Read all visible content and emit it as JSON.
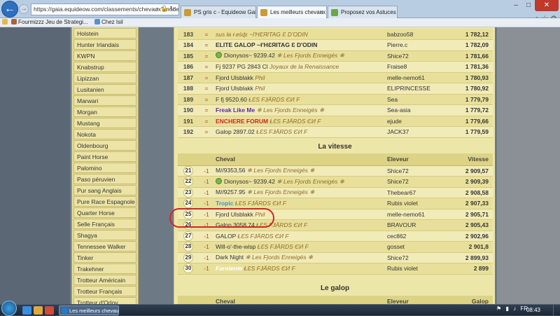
{
  "browser": {
    "address": "https://gaia.equideow.com/classements/chevaux?mode=purs",
    "tabs": [
      {
        "label": "PS gris c - Equideow Gaia"
      },
      {
        "label": "Les meilleurs chevaux - Equ..."
      },
      {
        "label": "Proposez vos Astuces"
      }
    ],
    "favorites": [
      {
        "label": "Fourmizzz  Jeu de Strategi..."
      },
      {
        "label": "Chez Isil"
      }
    ]
  },
  "sidebar": {
    "items": [
      {
        "label": "Holstein"
      },
      {
        "label": "Hunter Irlandais"
      },
      {
        "label": "KWPN"
      },
      {
        "label": "Knabstrup"
      },
      {
        "label": "Lipizzan"
      },
      {
        "label": "Lusitanien"
      },
      {
        "label": "Marwari"
      },
      {
        "label": "Morgan"
      },
      {
        "label": "Mustang"
      },
      {
        "label": "Nokota"
      },
      {
        "label": "Oldenbourg"
      },
      {
        "label": "Paint Horse"
      },
      {
        "label": "Palomino"
      },
      {
        "label": "Paso péruvien"
      },
      {
        "label": "Pur sang Anglais"
      },
      {
        "label": "Pure Race Espagnole"
      },
      {
        "label": "Quarter Horse"
      },
      {
        "label": "Selle Français"
      },
      {
        "label": "Shagya"
      },
      {
        "label": "Tennessee Walker"
      },
      {
        "label": "Tinker"
      },
      {
        "label": "Trakehner"
      },
      {
        "label": "Trotteur Américain"
      },
      {
        "label": "Trotteur Français"
      },
      {
        "label": "Trotteur d'Orlov"
      }
    ]
  },
  "top_table": {
    "rows": [
      {
        "rank": "183",
        "delta": "=",
        "horse": "sus ła ғ๏śɖɛ ~ɫ'HƐЯITAG Ɛ D'ODIN",
        "association": "",
        "owner": "babzoo58",
        "value": "1 782,12"
      },
      {
        "rank": "184",
        "delta": "=",
        "horse": "ELITE GALOP ~ɫ'HƐЯITAG Ɛ D'ODIN",
        "association": "",
        "owner": "Pierre.c",
        "value": "1 782,09"
      },
      {
        "rank": "185",
        "delta": "=",
        "horse": "Dionysos~ 9239.42",
        "association": "❄ Les Fjords Enneigés ❄",
        "owner": "Shice72",
        "value": "1 781,66"
      },
      {
        "rank": "186",
        "delta": "=",
        "horse": "Fj 9237 PG 2843 Cl",
        "association": "Joyaux de la Renaissance",
        "owner": "Fraise8",
        "value": "1 781,36"
      },
      {
        "rank": "187",
        "delta": "=",
        "horse": "Fjord Ulsblakk",
        "association": "Phil",
        "owner": "melle-nemo61",
        "value": "1 780,93"
      },
      {
        "rank": "188",
        "delta": "=",
        "horse": "Fjord Ulsblakk",
        "association": "Phil",
        "owner": "ELIPRINCESSE",
        "value": "1 780,92"
      },
      {
        "rank": "189",
        "delta": "=",
        "horse": "F fj 9520.60",
        "association": "ⱢƐS FɈӒRDS ЄИ F",
        "owner": "Sea",
        "value": "1 779,79"
      },
      {
        "rank": "190",
        "delta": "=",
        "horse": "Freak Like Me",
        "association": "❄ Les Fjords Enneigés ❄",
        "owner": "Sea-asia",
        "value": "1 779,72"
      },
      {
        "rank": "191",
        "delta": "=",
        "horse": "ENCHERE FORUM",
        "association": "ⱢƐS FɈӒRDS ЄИ F",
        "owner": "ejude",
        "value": "1 779,66"
      },
      {
        "rank": "192",
        "delta": "=",
        "horse": "Galop 2897.02",
        "association": "ⱢƐS FɈӒRDS ЄИ F",
        "owner": "JACK37",
        "value": "1 779,59"
      }
    ]
  },
  "vitesse": {
    "title": "La vitesse",
    "headers": {
      "horse": "Cheval",
      "owner": "Eleveur",
      "value": "Vitesse"
    },
    "rows": [
      {
        "rank": "21",
        "delta": "-1",
        "horse": "M//9353,56",
        "association": "❄ Les Fjords Enneigés ❄",
        "owner": "Shice72",
        "value": "2 909,57"
      },
      {
        "rank": "22",
        "delta": "-1",
        "horse": "Dionysos~ 9239.42",
        "association": "❄ Les Fjords Enneigés ❄",
        "owner": "Shice72",
        "value": "2 909,39"
      },
      {
        "rank": "23",
        "delta": "-1",
        "horse": "M//9257.95",
        "association": "❄ Les Fjords Enneigés ❄",
        "owner": "Thebear67",
        "value": "2 908,58"
      },
      {
        "rank": "24",
        "delta": "-1",
        "horse": "Tropic",
        "association": "ⱢƐS FɈӒRDS ЄИ F",
        "owner": "Rubis violet",
        "value": "2 907,33"
      },
      {
        "rank": "25",
        "delta": "-1",
        "horse": "Fjord Ulsblakk",
        "association": "Phil",
        "owner": "melle-nemo61",
        "value": "2 905,71"
      },
      {
        "rank": "26",
        "delta": "-1",
        "horse": "Galop 3058.74",
        "association": "ⱢƐS FɈӒRDS ЄИ F",
        "owner": "BRAVOUR",
        "value": "2 905,43"
      },
      {
        "rank": "27",
        "delta": "-1",
        "horse": "GALOP",
        "association": "ⱢƐS FɈӒRDS ЄИ F",
        "owner": "cec862",
        "value": "2 902,96"
      },
      {
        "rank": "28",
        "delta": "-1",
        "horse": "Will-o'-the-wisp",
        "association": "ⱢƐS FɈӒRDS ЄИ F",
        "owner": "gosset",
        "value": "2 901,8"
      },
      {
        "rank": "29",
        "delta": "-1",
        "horse": "Dark Night",
        "association": "❄ Les Fjords Enneigés ❄",
        "owner": "Shice72",
        "value": "2 899,93"
      },
      {
        "rank": "30",
        "delta": "-1",
        "horse": "Farniente",
        "association": "ⱢƐS FɈӒRDS ЄИ F",
        "owner": "Rubis violet",
        "value": "2 899"
      }
    ]
  },
  "galop": {
    "title": "Le galop",
    "headers": {
      "horse": "Cheval",
      "owner": "Eleveur",
      "value": "Galop"
    }
  },
  "taskbar": {
    "task_label": "Les meilleurs chevau...",
    "clock": "08:43"
  },
  "colors": {
    "panel": "#ede6a9",
    "sidebar": "#e5dc98",
    "highlight_circle": "#d8232a",
    "association_text": "#8e6a2a"
  }
}
